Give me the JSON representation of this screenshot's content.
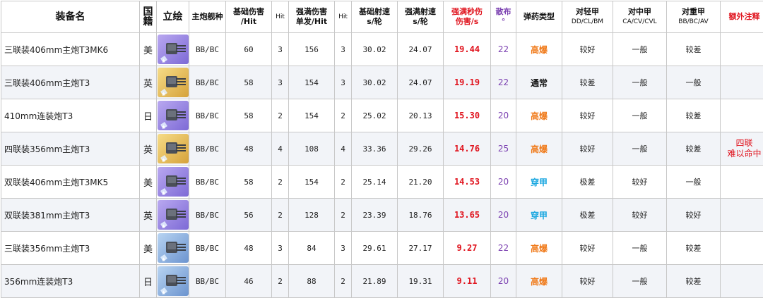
{
  "headers": {
    "name": "装备名",
    "nation": "国籍",
    "portrait": "立绘",
    "ship_type": "主炮舰种",
    "base_damage_l1": "基础伤害",
    "base_damage_l2": "/Hit",
    "hit1": "Hit",
    "max_damage_l1": "强満伤害",
    "max_damage_l2": "单发/Hit",
    "hit2": "Hit",
    "base_rof_l1": "基础射速",
    "base_rof_l2": "s/轮",
    "max_rof_l1": "强满射速",
    "max_rof_l2": "s/轮",
    "dps_l1": "强满秒伤",
    "dps_l2": "伤害/s",
    "spread_l1": "散布",
    "spread_l2": "°",
    "ammo": "弹药类型",
    "vs_light_l1": "对轻甲",
    "vs_light_l2": "DD/CL/BM",
    "vs_medium_l1": "对中甲",
    "vs_medium_l2": "CA/CV/CVL",
    "vs_heavy_l1": "对重甲",
    "vs_heavy_l2": "BB/BC/AV",
    "notes": "额外注释"
  },
  "colors": {
    "he": "#f07a1a",
    "ap": "#1aa7e0",
    "normal": "#111111",
    "dps": "#e0141e",
    "spread": "#7a3fb0"
  },
  "rows": [
    {
      "name": "三联装406mm主炮T3MK6",
      "nation": "美",
      "portrait": "purple",
      "ship_type": "BB/BC",
      "base_damage": "60",
      "hit1": "3",
      "max_damage": "156",
      "hit2": "3",
      "base_rof": "30.02",
      "max_rof": "24.07",
      "dps": "19.44",
      "spread": "22",
      "ammo": "高爆",
      "ammo_kind": "he",
      "vs_light": "较好",
      "vs_medium": "一般",
      "vs_heavy": "较差",
      "note": ""
    },
    {
      "name": "三联装406mm主炮T3",
      "nation": "英",
      "portrait": "gold",
      "ship_type": "BB/BC",
      "base_damage": "58",
      "hit1": "3",
      "max_damage": "154",
      "hit2": "3",
      "base_rof": "30.02",
      "max_rof": "24.07",
      "dps": "19.19",
      "spread": "22",
      "ammo": "通常",
      "ammo_kind": "normal",
      "vs_light": "较差",
      "vs_medium": "一般",
      "vs_heavy": "一般",
      "note": ""
    },
    {
      "name": "410mm连装炮T3",
      "nation": "日",
      "portrait": "purple",
      "ship_type": "BB/BC",
      "base_damage": "58",
      "hit1": "2",
      "max_damage": "154",
      "hit2": "2",
      "base_rof": "25.02",
      "max_rof": "20.13",
      "dps": "15.30",
      "spread": "20",
      "ammo": "高爆",
      "ammo_kind": "he",
      "vs_light": "较好",
      "vs_medium": "一般",
      "vs_heavy": "较差",
      "note": ""
    },
    {
      "name": "四联装356mm主炮T3",
      "nation": "英",
      "portrait": "gold",
      "ship_type": "BB/BC",
      "base_damage": "48",
      "hit1": "4",
      "max_damage": "108",
      "hit2": "4",
      "base_rof": "33.36",
      "max_rof": "29.26",
      "dps": "14.76",
      "spread": "25",
      "ammo": "高爆",
      "ammo_kind": "he",
      "vs_light": "较好",
      "vs_medium": "一般",
      "vs_heavy": "较差",
      "note": "四联\n难以命中"
    },
    {
      "name": "双联装406mm主炮T3MK5",
      "nation": "美",
      "portrait": "purple",
      "ship_type": "BB/BC",
      "base_damage": "58",
      "hit1": "2",
      "max_damage": "154",
      "hit2": "2",
      "base_rof": "25.14",
      "max_rof": "21.20",
      "dps": "14.53",
      "spread": "20",
      "ammo": "穿甲",
      "ammo_kind": "ap",
      "vs_light": "极差",
      "vs_medium": "较好",
      "vs_heavy": "一般",
      "note": ""
    },
    {
      "name": "双联装381mm主炮T3",
      "nation": "英",
      "portrait": "purple",
      "ship_type": "BB/BC",
      "base_damage": "56",
      "hit1": "2",
      "max_damage": "128",
      "hit2": "2",
      "base_rof": "23.39",
      "max_rof": "18.76",
      "dps": "13.65",
      "spread": "20",
      "ammo": "穿甲",
      "ammo_kind": "ap",
      "vs_light": "极差",
      "vs_medium": "较好",
      "vs_heavy": "较好",
      "note": ""
    },
    {
      "name": "三联装356mm主炮T3",
      "nation": "美",
      "portrait": "blue",
      "ship_type": "BB/BC",
      "base_damage": "48",
      "hit1": "3",
      "max_damage": "84",
      "hit2": "3",
      "base_rof": "29.61",
      "max_rof": "27.17",
      "dps": "9.27",
      "spread": "22",
      "ammo": "高爆",
      "ammo_kind": "he",
      "vs_light": "较好",
      "vs_medium": "一般",
      "vs_heavy": "较差",
      "note": ""
    },
    {
      "name": "356mm连装炮T3",
      "nation": "日",
      "portrait": "blue",
      "ship_type": "BB/BC",
      "base_damage": "46",
      "hit1": "2",
      "max_damage": "88",
      "hit2": "2",
      "base_rof": "21.89",
      "max_rof": "19.31",
      "dps": "9.11",
      "spread": "20",
      "ammo": "高爆",
      "ammo_kind": "he",
      "vs_light": "较好",
      "vs_medium": "一般",
      "vs_heavy": "较差",
      "note": ""
    }
  ]
}
